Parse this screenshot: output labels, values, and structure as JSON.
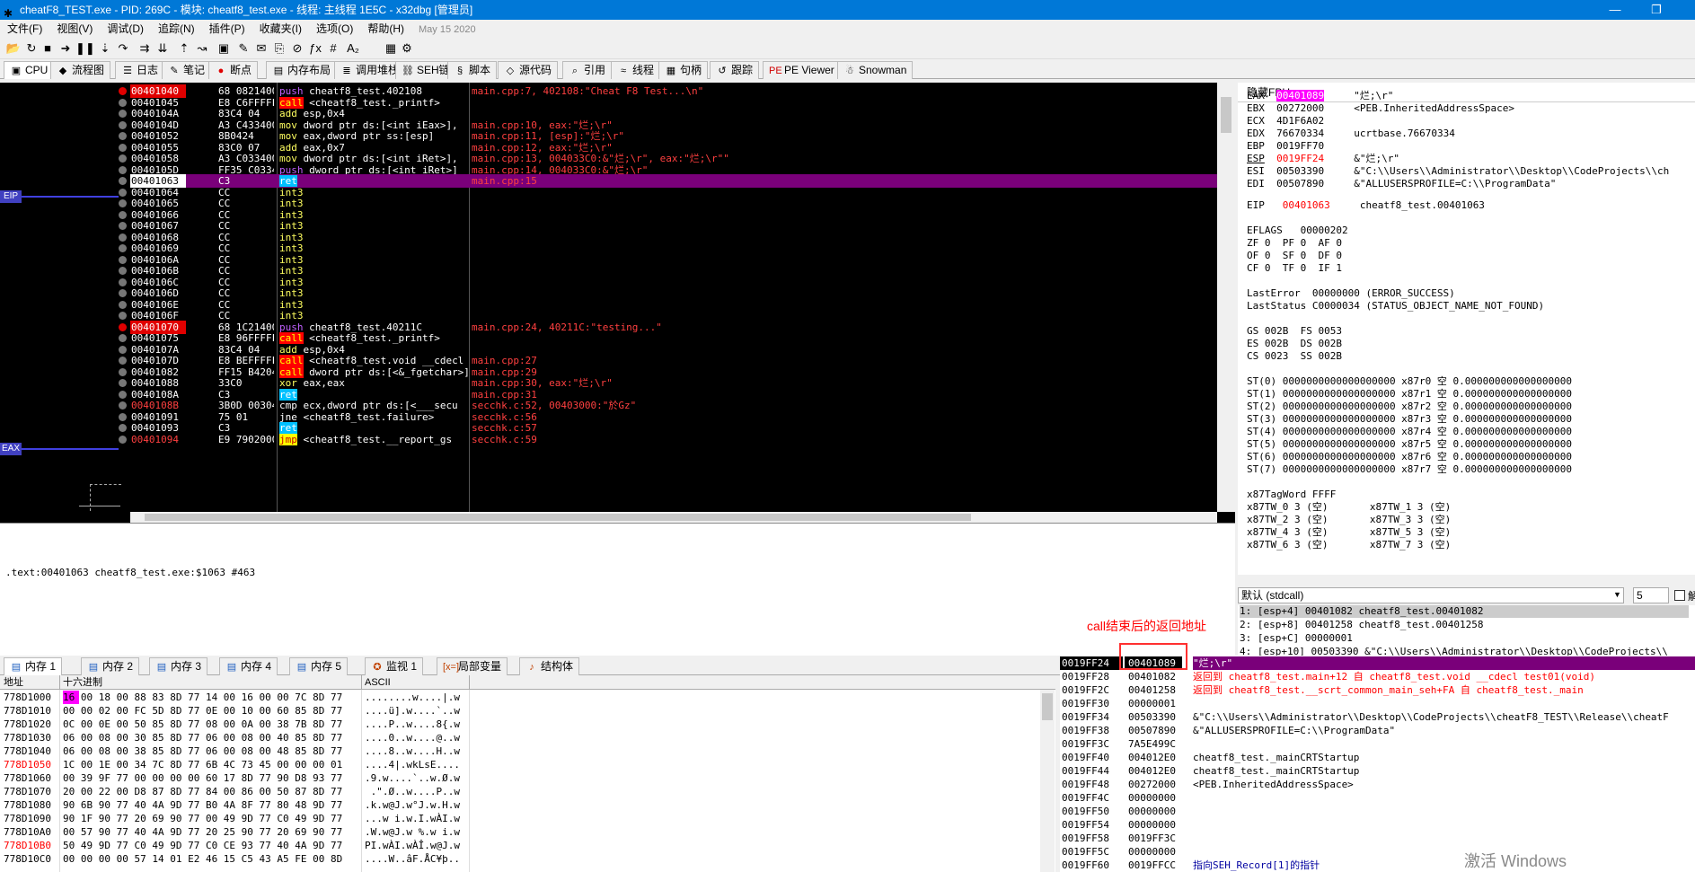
{
  "window": {
    "title": "cheatF8_TEST.exe - PID: 269C - 模块: cheatf8_test.exe - 线程: 主线程 1E5C - x32dbg [管理员]",
    "minimize": "—",
    "maximize": "❐"
  },
  "menu": {
    "items": [
      "文件(F)",
      "视图(V)",
      "调试(D)",
      "追踪(N)",
      "插件(P)",
      "收藏夹(I)",
      "选项(O)",
      "帮助(H)"
    ],
    "date": "May 15 2020"
  },
  "toolbar": {
    "icons": [
      [
        "open-icon",
        "📂"
      ],
      [
        "restart-icon",
        "↻"
      ],
      [
        "stop-icon",
        "■"
      ],
      [
        "run-icon",
        "➜"
      ],
      [
        "pause-icon",
        "❚❚"
      ],
      [
        "step-into-icon",
        "⇣"
      ],
      [
        "step-over-icon",
        "↷"
      ],
      [
        "trace-into-icon",
        "⇉"
      ],
      [
        "trace-over-icon",
        "⇊"
      ],
      [
        "execute-till-return-icon",
        "⇡"
      ],
      [
        "run-to-user-code-icon",
        "↝"
      ],
      [
        "scylla-icon",
        "▣"
      ],
      [
        "patch-icon",
        "✎"
      ],
      [
        "comment-icon",
        "✉"
      ],
      [
        "label-icon",
        "⎘"
      ],
      [
        "bookmark-icon",
        "⊘"
      ],
      [
        "function-icon",
        "ƒx"
      ],
      [
        "hash-icon",
        "#"
      ],
      [
        "strings-icon",
        "A₂"
      ],
      [
        "calculator-icon",
        "▦"
      ],
      [
        "settings-icon",
        "⚙"
      ]
    ]
  },
  "tabs": [
    {
      "label": "CPU",
      "icon": "cpu-icon"
    },
    {
      "label": "流程图",
      "icon": "graph-icon"
    },
    {
      "label": "日志",
      "icon": "log-icon"
    },
    {
      "label": "笔记",
      "icon": "notes-icon"
    },
    {
      "label": "断点",
      "icon": "breakpoint-icon"
    },
    {
      "label": "内存布局",
      "icon": "memory-map-icon"
    },
    {
      "label": "调用堆栈",
      "icon": "call-stack-icon"
    },
    {
      "label": "SEH链",
      "icon": "seh-icon"
    },
    {
      "label": "脚本",
      "icon": "script-icon"
    },
    {
      "label": "源代码",
      "icon": "source-icon"
    },
    {
      "label": "引用",
      "icon": "references-icon"
    },
    {
      "label": "线程",
      "icon": "threads-icon"
    },
    {
      "label": "句柄",
      "icon": "handles-icon"
    },
    {
      "label": "跟踪",
      "icon": "trace-icon"
    },
    {
      "label": "PE Viewer",
      "icon": "pe-viewer-icon"
    },
    {
      "label": "Snowman",
      "icon": "snowman-icon"
    }
  ],
  "labels": {
    "eip": "EIP",
    "eax": "EAX"
  },
  "disasm": [
    {
      "addr": "00401040",
      "bytes": "68 08214000",
      "mn": "push",
      "ops": " cheatf8_test.402108",
      "cmt": "main.cpp:7, 402108:\"Cheat F8 Test...\\n\"",
      "bp": true
    },
    {
      "addr": "00401045",
      "bytes": "E8 C6FFFFFF",
      "mn": "call",
      "ops": " <cheatf8_test._printf>",
      "cmt": ""
    },
    {
      "addr": "0040104A",
      "bytes": "83C4 04",
      "mn": "add",
      "ops": " esp,0x4",
      "cmt": ""
    },
    {
      "addr": "0040104D",
      "bytes": "A3 C4334000",
      "mn": "mov",
      "ops": " dword ptr ds:[<int iEax>],",
      "cmt": "main.cpp:10, eax:\"烂;\\r\""
    },
    {
      "addr": "00401052",
      "bytes": "8B0424",
      "mn": "mov",
      "ops": " eax,dword ptr ss:[esp]",
      "cmt": "main.cpp:11, [esp]:\"烂;\\r\""
    },
    {
      "addr": "00401055",
      "bytes": "83C0 07",
      "mn": "add",
      "ops": " eax,0x7",
      "cmt": "main.cpp:12, eax:\"烂;\\r\""
    },
    {
      "addr": "00401058",
      "bytes": "A3 C0334000",
      "mn": "mov",
      "ops": " dword ptr ds:[<int iRet>],",
      "cmt": "main.cpp:13, 004033C0:&\"烂;\\r\", eax:\"烂;\\r\"\""
    },
    {
      "addr": "0040105D",
      "bytes": "FF35 C0334000",
      "mn": "push",
      "ops": " dword ptr ds:[<int iRet>]",
      "cmt": "main.cpp:14, 004033C0:&\"烂;\\r\""
    },
    {
      "addr": "00401063",
      "bytes": "C3",
      "mn": "ret",
      "ops": "",
      "cmt": "main.cpp:15",
      "eip": true
    },
    {
      "addr": "00401064",
      "bytes": "CC",
      "mn": "int3",
      "ops": "",
      "cmt": ""
    },
    {
      "addr": "00401065",
      "bytes": "CC",
      "mn": "int3",
      "ops": "",
      "cmt": ""
    },
    {
      "addr": "00401066",
      "bytes": "CC",
      "mn": "int3",
      "ops": "",
      "cmt": ""
    },
    {
      "addr": "00401067",
      "bytes": "CC",
      "mn": "int3",
      "ops": "",
      "cmt": ""
    },
    {
      "addr": "00401068",
      "bytes": "CC",
      "mn": "int3",
      "ops": "",
      "cmt": ""
    },
    {
      "addr": "00401069",
      "bytes": "CC",
      "mn": "int3",
      "ops": "",
      "cmt": ""
    },
    {
      "addr": "0040106A",
      "bytes": "CC",
      "mn": "int3",
      "ops": "",
      "cmt": ""
    },
    {
      "addr": "0040106B",
      "bytes": "CC",
      "mn": "int3",
      "ops": "",
      "cmt": ""
    },
    {
      "addr": "0040106C",
      "bytes": "CC",
      "mn": "int3",
      "ops": "",
      "cmt": ""
    },
    {
      "addr": "0040106D",
      "bytes": "CC",
      "mn": "int3",
      "ops": "",
      "cmt": ""
    },
    {
      "addr": "0040106E",
      "bytes": "CC",
      "mn": "int3",
      "ops": "",
      "cmt": ""
    },
    {
      "addr": "0040106F",
      "bytes": "CC",
      "mn": "int3",
      "ops": "",
      "cmt": ""
    },
    {
      "addr": "00401070",
      "bytes": "68 1C214000",
      "mn": "push",
      "ops": " cheatf8_test.40211C",
      "cmt": "main.cpp:24, 40211C:\"testing...\"",
      "bp": true
    },
    {
      "addr": "00401075",
      "bytes": "E8 96FFFFFF",
      "mn": "call",
      "ops": " <cheatf8_test._printf>",
      "cmt": ""
    },
    {
      "addr": "0040107A",
      "bytes": "83C4 04",
      "mn": "add",
      "ops": " esp,0x4",
      "cmt": ""
    },
    {
      "addr": "0040107D",
      "bytes": "E8 BEFFFFFF",
      "mn": "call",
      "ops": " <cheatf8_test.void __cdecl",
      "cmt": "main.cpp:27"
    },
    {
      "addr": "00401082",
      "bytes": "FF15 B4204000",
      "mn": "call",
      "ops": " dword ptr ds:[<&_fgetchar>]",
      "cmt": "main.cpp:29"
    },
    {
      "addr": "00401088",
      "bytes": "33C0",
      "mn": "xor",
      "ops": " eax,eax",
      "cmt": "main.cpp:30, eax:\"烂;\\r\""
    },
    {
      "addr": "0040108A",
      "bytes": "C3",
      "mn": "ret",
      "ops": "",
      "cmt": "main.cpp:31"
    },
    {
      "addr": "0040108B",
      "bytes": "3B0D 00304000",
      "mn": "cmp",
      "ops": " ecx,dword ptr ds:[<___secu",
      "cmt": "secchk.c:52, 00403000:\"於Gz\"",
      "red": true
    },
    {
      "addr": "00401091",
      "bytes": "75 01",
      "mn": "jne",
      "ops": " <cheatf8_test.failure>",
      "cmt": "secchk.c:56"
    },
    {
      "addr": "00401093",
      "bytes": "C3",
      "mn": "ret",
      "ops": "",
      "cmt": "secchk.c:57"
    },
    {
      "addr": "00401094",
      "bytes": "E9 79020000",
      "mn": "jmp",
      "ops": " <cheatf8_test.__report_gs",
      "cmt": "secchk.c:59",
      "red": true
    }
  ],
  "regs": {
    "header": "隐藏FPU",
    "lines": [
      [
        "EAX",
        "00401089",
        "\"烂;\\r\""
      ],
      [
        "EBX",
        "00272000",
        "<PEB.InheritedAddressSpace>"
      ],
      [
        "ECX",
        "4D1F6A02",
        ""
      ],
      [
        "EDX",
        "76670334",
        "ucrtbase.76670334"
      ],
      [
        "EBP",
        "0019FF70",
        ""
      ],
      [
        "ESP",
        "0019FF24",
        "&\"烂;\\r\""
      ],
      [
        "ESI",
        "00503390",
        "&\"C:\\\\Users\\\\Administrator\\\\Desktop\\\\CodeProjects\\\\ch"
      ],
      [
        "EDI",
        "00507890",
        "&\"ALLUSERSPROFILE=C:\\\\ProgramData\""
      ]
    ],
    "eip": [
      "EIP",
      "00401063",
      "cheatf8_test.00401063"
    ],
    "flags": [
      "EFLAGS   00000202",
      "ZF 0  PF 0  AF 0",
      "OF 0  SF 0  DF 0",
      "CF 0  TF 0  IF 1"
    ],
    "err": [
      "LastError  00000000 (ERROR_SUCCESS)",
      "LastStatus C0000034 (STATUS_OBJECT_NAME_NOT_FOUND)"
    ],
    "seg": [
      "GS 002B  FS 0053",
      "ES 002B  DS 002B",
      "CS 0023  SS 002B"
    ],
    "fpu": [
      "ST(0) 0000000000000000000 x87r0 空 0.000000000000000000",
      "ST(1) 0000000000000000000 x87r1 空 0.000000000000000000",
      "ST(2) 0000000000000000000 x87r2 空 0.000000000000000000",
      "ST(3) 0000000000000000000 x87r3 空 0.000000000000000000",
      "ST(4) 0000000000000000000 x87r4 空 0.000000000000000000",
      "ST(5) 0000000000000000000 x87r5 空 0.000000000000000000",
      "ST(6) 0000000000000000000 x87r6 空 0.000000000000000000",
      "ST(7) 0000000000000000000 x87r7 空 0.000000000000000000"
    ],
    "tag": [
      "x87TagWord FFFF",
      "x87TW_0 3 (空)       x87TW_1 3 (空)",
      "x87TW_2 3 (空)       x87TW_3 3 (空)",
      "x87TW_4 3 (空)       x87TW_5 3 (空)",
      "x87TW_6 3 (空)       x87TW_7 3 (空)"
    ]
  },
  "info": {
    "text": ".text:00401063 cheatf8_test.exe:$1063 #463"
  },
  "annotation": {
    "text": "call结束后的返回地址"
  },
  "callconv": {
    "selected": "默认 (stdcall)",
    "count": "5",
    "unlock_label": "解锁",
    "rows": [
      "1: [esp+4] 00401082 cheatf8_test.00401082",
      "2: [esp+8] 00401258 cheatf8_test.00401258",
      "3: [esp+C] 00000001",
      "4: [esp+10] 00503390 &\"C:\\\\Users\\\\Administrator\\\\Desktop\\\\CodeProjects\\\\"
    ]
  },
  "bottom_tabs": [
    {
      "label": "内存 1",
      "icon": "memory-icon"
    },
    {
      "label": "内存 2",
      "icon": "memory-icon"
    },
    {
      "label": "内存 3",
      "icon": "memory-icon"
    },
    {
      "label": "内存 4",
      "icon": "memory-icon"
    },
    {
      "label": "内存 5",
      "icon": "memory-icon"
    },
    {
      "label": "监视 1",
      "icon": "watch-icon"
    },
    {
      "label": "局部变量",
      "icon": "locals-icon"
    },
    {
      "label": "结构体",
      "icon": "struct-icon"
    }
  ],
  "dump": {
    "headers": [
      "地址",
      "十六进制",
      "ASCII"
    ],
    "rows": [
      [
        "778D1000",
        "16 00 18 00 88 83 8D 77 14 00 16 00 00 7C 8D 77",
        "........w....|.w",
        false
      ],
      [
        "778D1010",
        "00 00 02 00 FC 5D 8D 77 0E 00 10 00 60 85 8D 77",
        "....ü].w....`..w",
        false
      ],
      [
        "778D1020",
        "0C 00 0E 00 50 85 8D 77 08 00 0A 00 38 7B 8D 77",
        "....P..w....8{.w",
        false
      ],
      [
        "778D1030",
        "06 00 08 00 30 85 8D 77 06 00 08 00 40 85 8D 77",
        "....0..w....@..w",
        false
      ],
      [
        "778D1040",
        "06 00 08 00 38 85 8D 77 06 00 08 00 48 85 8D 77",
        "....8..w....H..w",
        false
      ],
      [
        "778D1050",
        "1C 00 1E 00 34 7C 8D 77 6B 4C 73 45 00 00 00 01",
        "....4|.wkLsE....",
        true
      ],
      [
        "778D1060",
        "00 39 9F 77 00 00 00 00 60 17 8D 77 90 D8 93 77",
        ".9.w....`..w.Ø.w",
        false
      ],
      [
        "778D1070",
        "20 00 22 00 D8 87 8D 77 84 00 86 00 50 87 8D 77",
        " .\".Ø..w....P..w",
        false
      ],
      [
        "778D1080",
        "90 6B 90 77 40 4A 9D 77 B0 4A 8F 77 80 48 9D 77",
        ".k.w@J.w°J.w.H.w",
        false
      ],
      [
        "778D1090",
        "90 1F 90 77 20 69 90 77 00 49 9D 77 C0 49 9D 77",
        "...w i.w.I.wÀI.w",
        false
      ],
      [
        "778D10A0",
        "00 57 90 77 40 4A 9D 77 20 25 90 77 20 69 90 77",
        ".W.w@J.w %.w i.w",
        false
      ],
      [
        "778D10B0",
        "50 49 9D 77 C0 49 9D 77 C0 CE 93 77 40 4A 9D 77",
        "PI.wÀI.wÀÎ.w@J.w",
        true
      ],
      [
        "778D10C0",
        "00 00 00 00 57 14 01 E2 46 15 C5 43 A5 FE 00 8D",
        "....W..âF.ÅC¥þ..",
        false
      ]
    ]
  },
  "stack": {
    "rows": [
      [
        "0019FF24",
        "00401089",
        "\"烂;\\r\"",
        "esp"
      ],
      [
        "0019FF28",
        "00401082",
        "返回到 cheatf8_test.main+12 自 cheatf8_test.void __cdecl test01(void)",
        "red"
      ],
      [
        "0019FF2C",
        "00401258",
        "返回到 cheatf8_test.__scrt_common_main_seh+FA 自 cheatf8_test._main",
        "red"
      ],
      [
        "0019FF30",
        "00000001",
        "",
        ""
      ],
      [
        "0019FF34",
        "00503390",
        "&\"C:\\\\Users\\\\Administrator\\\\Desktop\\\\CodeProjects\\\\cheatF8_TEST\\\\Release\\\\cheatF",
        ""
      ],
      [
        "0019FF38",
        "00507890",
        "&\"ALLUSERSPROFILE=C:\\\\ProgramData\"",
        ""
      ],
      [
        "0019FF3C",
        "7A5E499C",
        "",
        ""
      ],
      [
        "0019FF40",
        "004012E0",
        "cheatf8_test._mainCRTStartup",
        ""
      ],
      [
        "0019FF44",
        "004012E0",
        "cheatf8_test._mainCRTStartup",
        ""
      ],
      [
        "0019FF48",
        "00272000",
        "<PEB.InheritedAddressSpace>",
        ""
      ],
      [
        "0019FF4C",
        "00000000",
        "",
        ""
      ],
      [
        "0019FF50",
        "00000000",
        "",
        ""
      ],
      [
        "0019FF54",
        "00000000",
        "",
        ""
      ],
      [
        "0019FF58",
        "0019FF3C",
        "",
        ""
      ],
      [
        "0019FF5C",
        "00000000",
        "",
        ""
      ],
      [
        "0019FF60",
        "0019FFCC",
        "指向SEH_Record[1]的指针",
        "blue"
      ]
    ]
  },
  "watermark": "激活 Windows"
}
